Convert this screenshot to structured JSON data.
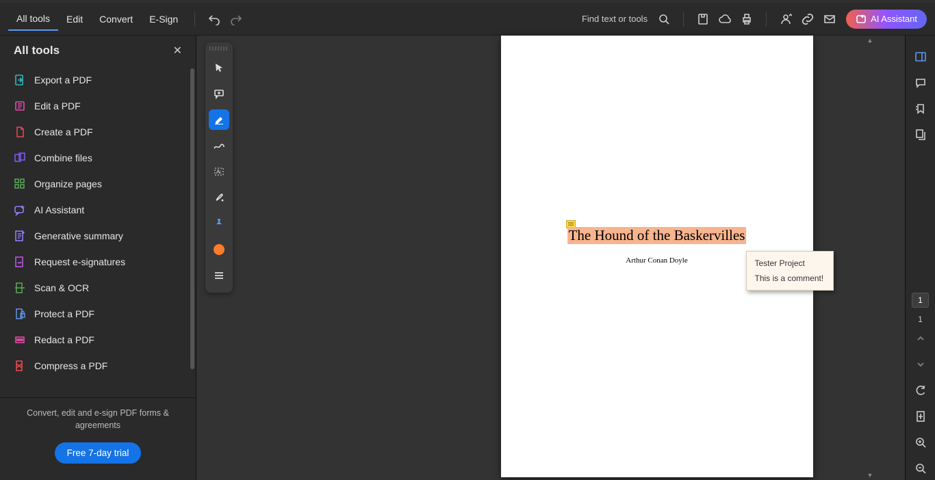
{
  "topbar": {
    "tabs": [
      "All tools",
      "Edit",
      "Convert",
      "E-Sign"
    ],
    "active_tab": 0,
    "search_label": "Find text or tools",
    "ai_label": "AI Assistant"
  },
  "sidebar": {
    "title": "All tools",
    "items": [
      {
        "label": "Export a PDF",
        "color": "#34b6c1",
        "icon": "export"
      },
      {
        "label": "Edit a PDF",
        "color": "#e34ba9",
        "icon": "edit"
      },
      {
        "label": "Create a PDF",
        "color": "#e34850",
        "icon": "create"
      },
      {
        "label": "Combine files",
        "color": "#7e57f1",
        "icon": "combine"
      },
      {
        "label": "Organize pages",
        "color": "#55a556",
        "icon": "organize"
      },
      {
        "label": "AI Assistant",
        "color": "#947bf8",
        "icon": "ai"
      },
      {
        "label": "Generative summary",
        "color": "#947bf8",
        "icon": "summary"
      },
      {
        "label": "Request e-signatures",
        "color": "#b955e0",
        "icon": "sign"
      },
      {
        "label": "Scan & OCR",
        "color": "#55a556",
        "icon": "scan"
      },
      {
        "label": "Protect a PDF",
        "color": "#5c8fe0",
        "icon": "protect"
      },
      {
        "label": "Redact a PDF",
        "color": "#e34ba9",
        "icon": "redact"
      },
      {
        "label": "Compress a PDF",
        "color": "#e34850",
        "icon": "compress"
      }
    ],
    "footer_text": "Convert, edit and e-sign PDF forms & agreements",
    "trial_label": "Free 7-day trial"
  },
  "quicktools": [
    {
      "name": "select-tool",
      "selected": false
    },
    {
      "name": "comment-tool",
      "selected": false
    },
    {
      "name": "highlight-tool",
      "selected": true
    },
    {
      "name": "draw-tool",
      "selected": false
    },
    {
      "name": "textbox-tool",
      "selected": false
    },
    {
      "name": "erase-tool",
      "selected": false
    },
    {
      "name": "pin-tool",
      "selected": false
    },
    {
      "name": "color-swatch",
      "selected": false
    },
    {
      "name": "more-tool",
      "selected": false
    }
  ],
  "document": {
    "title": "The Hound of the Baskervilles",
    "author": "Arthur Conan Doyle",
    "comment": {
      "author": "Tester Project",
      "body": "This is a comment!"
    }
  },
  "rightbar": {
    "page_current": "1",
    "page_total": "1"
  }
}
